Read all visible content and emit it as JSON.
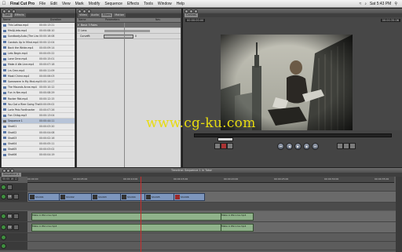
{
  "menubar": {
    "app_name": "Final Cut Pro",
    "items": [
      "File",
      "Edit",
      "View",
      "Mark",
      "Modify",
      "Sequence",
      "Effects",
      "Tools",
      "Window",
      "Help"
    ],
    "clock": "Sat 5:43 PM"
  },
  "browser": {
    "tabs": [
      "Tutor",
      "Effects"
    ],
    "columns": [
      "Name",
      "Duration"
    ],
    "items": [
      {
        "name": "This Latlwa.mp4",
        "dur": "00:00:13:21",
        "kind": "clip"
      },
      {
        "name": "Mrs&Lieto.mp4",
        "dur": "00:00:08:10",
        "kind": "clip"
      },
      {
        "name": "Sundbady.Auto.(The Lira Ma)",
        "dur": "00:00:16:08",
        "kind": "clip"
      },
      {
        "name": "Condols Up In Mind.mp4",
        "dur": "00:00:12:04",
        "kind": "clip"
      },
      {
        "name": "Back the Wride.mp4",
        "dur": "00:00:09:14",
        "kind": "clip"
      },
      {
        "name": "Lets Begin.mp4",
        "dur": "00:00:05:22",
        "kind": "clip"
      },
      {
        "name": "Lone Grne.mp4",
        "dur": "00:00:15:01",
        "kind": "clip"
      },
      {
        "name": "Make A Wa Line.mp4",
        "dur": "00:00:07:18",
        "kind": "clip"
      },
      {
        "name": "Lrs Cmn.mp4",
        "dur": "00:00:11:09",
        "kind": "clip"
      },
      {
        "name": "Mostl Chirnr.mp4",
        "dur": "00:00:06:03",
        "kind": "clip"
      },
      {
        "name": "Somewere In My Mnd.mp4",
        "dur": "00:00:14:27",
        "kind": "clip"
      },
      {
        "name": "The Mounds Anne.mp4",
        "dur": "00:00:10:12",
        "kind": "clip"
      },
      {
        "name": "Fun in Nm.mp4",
        "dur": "00:00:08:29",
        "kind": "clip"
      },
      {
        "name": "Rocker Rbt.mp4",
        "dur": "00:00:12:15",
        "kind": "clip"
      },
      {
        "name": "You Got a Rlee Going Then.mp4",
        "dur": "00:00:09:02",
        "kind": "clip"
      },
      {
        "name": "Lorle Pelo Fordtnarter",
        "dur": "00:00:07:26",
        "kind": "clip"
      },
      {
        "name": "Fon Chlbg.mp3",
        "dur": "00:00:13:04",
        "kind": "clip"
      },
      {
        "name": "Sequence 1",
        "dur": "00:00:44:11",
        "kind": "seq"
      },
      {
        "name": "Shot01",
        "dur": "00:00:03:20",
        "kind": "clip"
      },
      {
        "name": "Shot02",
        "dur": "00:00:04:08",
        "kind": "clip"
      },
      {
        "name": "Shot03",
        "dur": "00:00:02:16",
        "kind": "clip"
      },
      {
        "name": "Shot04",
        "dur": "00:00:05:11",
        "kind": "clip"
      },
      {
        "name": "Shot05",
        "dur": "00:00:03:02",
        "kind": "clip"
      },
      {
        "name": "Shot06",
        "dur": "00:00:04:19",
        "kind": "clip"
      }
    ]
  },
  "viewer": {
    "tabs": [
      "Video",
      "Audio",
      "Filters",
      "Motion"
    ],
    "columns": [
      "Name",
      "Parameters",
      "Nav"
    ],
    "rows": [
      {
        "name": "Basic 3 Roles",
        "param": ""
      },
      {
        "name": "Lens",
        "param": ""
      },
      {
        "name": "Curvefit",
        "param": "0"
      }
    ]
  },
  "canvas": {
    "tabs": [
      "Canvas"
    ],
    "timecode_left": "00:00:00:00",
    "timecode_right": "00:00:35:06"
  },
  "timeline": {
    "title": "Timeline: Sequence 1 in Tutor",
    "tab": "Sequence 1",
    "timecode": "00:00:16:12",
    "ruler": [
      "00:00:00",
      "00:00:05:00",
      "00:00:10:00",
      "00:00:15:00",
      "00:00:20:00",
      "00:00:25:00",
      "00:00:30:00",
      "00:00:35:00"
    ],
    "video_clips": [
      "Shot01",
      "Shot02",
      "Shot03",
      "Shot04",
      "Shot05",
      "Shot06"
    ],
    "audio_clips": [
      "Make A Wa Line.mp4",
      "Make A Wa Line.mp4",
      "Make A Wa Line.mp4",
      "Make A Wa Line.mp4"
    ],
    "track_labels": [
      "V1",
      "A1",
      "A2"
    ]
  },
  "watermark": "www.cg-ku.com"
}
